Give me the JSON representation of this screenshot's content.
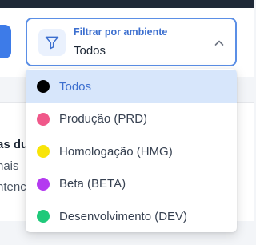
{
  "filter": {
    "label": "Filtrar por ambiente",
    "value": "Todos",
    "icon": "filter-icon",
    "chevron_icon": "chevron-up-icon"
  },
  "background_text": {
    "line1": "as du",
    "line2": "nais",
    "line3": "ntenc"
  },
  "options": [
    {
      "label": "Todos",
      "color": "#000000",
      "selected": true
    },
    {
      "label": "Produção (PRD)",
      "color": "#f0588a",
      "selected": false
    },
    {
      "label": "Homologação (HMG)",
      "color": "#f8e408",
      "selected": false
    },
    {
      "label": "Beta (BETA)",
      "color": "#b43af0",
      "selected": false
    },
    {
      "label": "Desenvolvimento (DEV)",
      "color": "#1fc97a",
      "selected": false
    }
  ]
}
